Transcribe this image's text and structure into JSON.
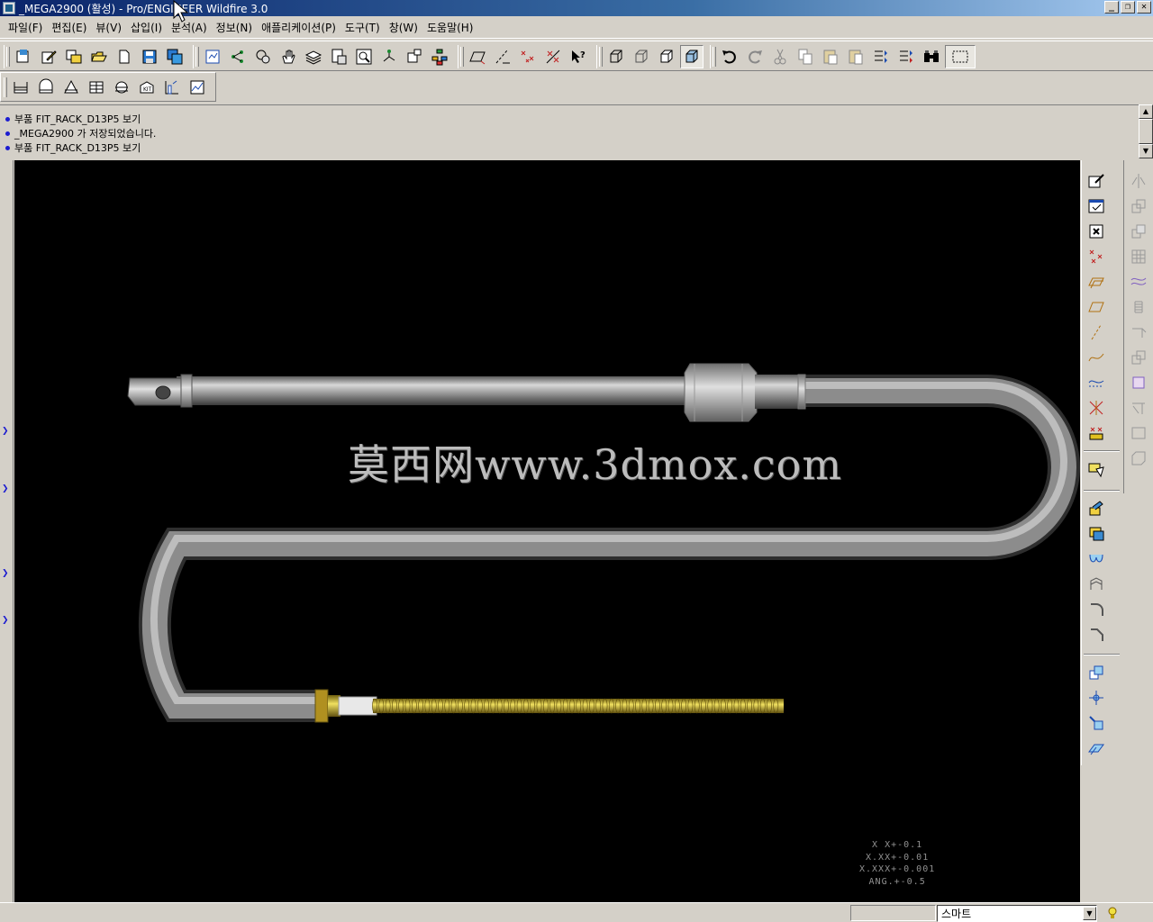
{
  "window": {
    "title": "_MEGA2900 (활성) - Pro/ENGINEER Wildfire 3.0",
    "minimize": "_",
    "restore": "❐",
    "close": "✕"
  },
  "menu": {
    "items": [
      {
        "label": "파일(F)"
      },
      {
        "label": "편집(E)"
      },
      {
        "label": "뷰(V)"
      },
      {
        "label": "삽입(I)"
      },
      {
        "label": "분석(A)"
      },
      {
        "label": "정보(N)"
      },
      {
        "label": "애플리케이션(P)"
      },
      {
        "label": "도구(T)"
      },
      {
        "label": "창(W)"
      },
      {
        "label": "도움말(H)"
      }
    ]
  },
  "toolbar": {
    "group1": [
      "new-icon",
      "open-icon",
      "save-icon"
    ],
    "group2": [
      "regenerate-icon",
      "spin-center-icon",
      "datum-icon",
      "repaint-icon"
    ],
    "group3": [
      "sketch-icon",
      "plane-icon",
      "point-icon",
      "context-help-icon"
    ],
    "group4": [
      "wireframe-icon",
      "hidden-line-icon",
      "no-hidden-icon",
      "shading-icon"
    ],
    "group5": [
      "undo-icon",
      "redo-icon",
      "cut-icon",
      "copy-icon",
      "paste-icon"
    ]
  },
  "messages": [
    {
      "text": "부품 FIT_RACK_D13P5 보기"
    },
    {
      "text": "_MEGA2900 가 저장되었습니다."
    },
    {
      "text": "부품 FIT_RACK_D13P5 보기"
    }
  ],
  "viewport": {
    "watermark": "莫西网www.3dmox.com",
    "tolerance": [
      "X X+-0.1",
      "X.XX+-0.01",
      "X.XXX+-0.001",
      "ANG.+-0.5"
    ],
    "colors": {
      "background": "#000000",
      "tube": "#a8a8a8",
      "thread": "#d8c830"
    }
  },
  "status": {
    "filter_value": "스마트"
  }
}
